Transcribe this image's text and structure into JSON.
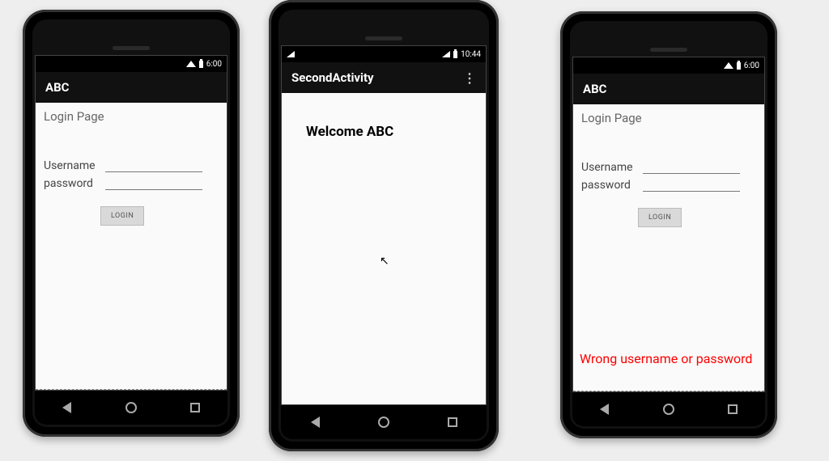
{
  "phone1": {
    "status_time": "6:00",
    "app_title": "ABC",
    "page_title": "Login Page",
    "username_label": "Username",
    "password_label": "password",
    "login_button": "LOGIN"
  },
  "phone2": {
    "status_time": "10:44",
    "app_title": "SecondActivity",
    "welcome_text": "Welcome ABC"
  },
  "phone3": {
    "status_time": "6:00",
    "app_title": "ABC",
    "page_title": "Login Page",
    "username_label": "Username",
    "password_label": "password",
    "login_button": "LOGIN",
    "error_text": "Wrong username or password"
  }
}
